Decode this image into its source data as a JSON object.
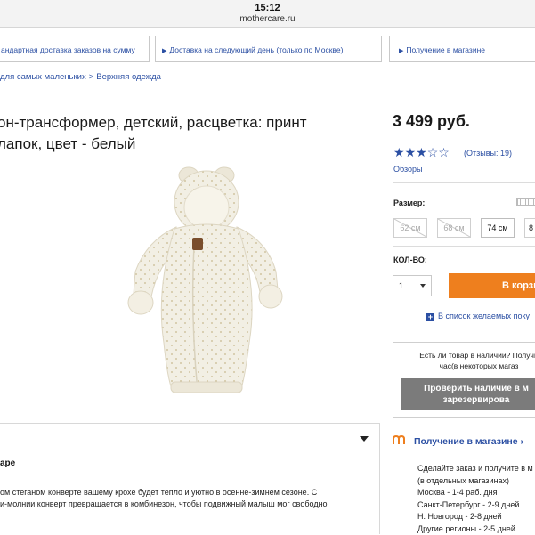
{
  "status_bar": {
    "time": "15:12",
    "url": "mothercare.ru"
  },
  "delivery": [
    {
      "label": "андартная доставка заказов на сумму"
    },
    {
      "label": "Доставка на следующий день (только по Москве)"
    },
    {
      "label": "Получение в магазине"
    }
  ],
  "breadcrumb": [
    "для самых маленьких",
    "Верхняя одежда"
  ],
  "product": {
    "title_line1": "он-трансформер, детский, расцветка: принт",
    "title_line2": "лапок, цвет - белый",
    "price": "3 499 руб.",
    "rating": 3,
    "rating_max": 5,
    "reviews": "(Отзывы: 19)",
    "reviews_link": "Обзоры",
    "size_label": "Размер:",
    "sizes": [
      {
        "label": "62 см",
        "available": false
      },
      {
        "label": "68 см",
        "available": false
      },
      {
        "label": "74 см",
        "available": true,
        "selected": true
      },
      {
        "label": "8",
        "available": true
      }
    ],
    "qty_label": "КОЛ-ВО:",
    "qty_value": "1",
    "cart_button": "В корзи",
    "wishlist": "В список желаемых поку"
  },
  "availability": {
    "question_line1": "Есть ли товар в наличии? Получи",
    "question_line2": "час(в некоторых магаз",
    "button_line1": "Проверить наличие в м",
    "button_line2": "зарезервирова"
  },
  "pickup": {
    "title": "Получение в магазине",
    "arrow": "›",
    "lines": [
      "Сделайте заказ и получите в м",
      "(в отдельных магазинах)",
      "Москва - 1-4 раб. дня",
      "Санкт-Петербург - 2-9 дней",
      "Н. Новгород - 2-8 дней",
      "Другие регионы - 2-5 дней"
    ]
  },
  "description": {
    "title": "аре",
    "line1": "ом стеганом конверте вашему крохе будет тепло и уютно в осенне-зимнем сезоне. С",
    "line2": "и-молнии конверт превращается в комбинезон, чтобы подвижный малыш мог свободно"
  },
  "colors": {
    "link": "#2b4fa3",
    "cart": "#ee7f1e",
    "avail_button": "#7b7b7b"
  }
}
